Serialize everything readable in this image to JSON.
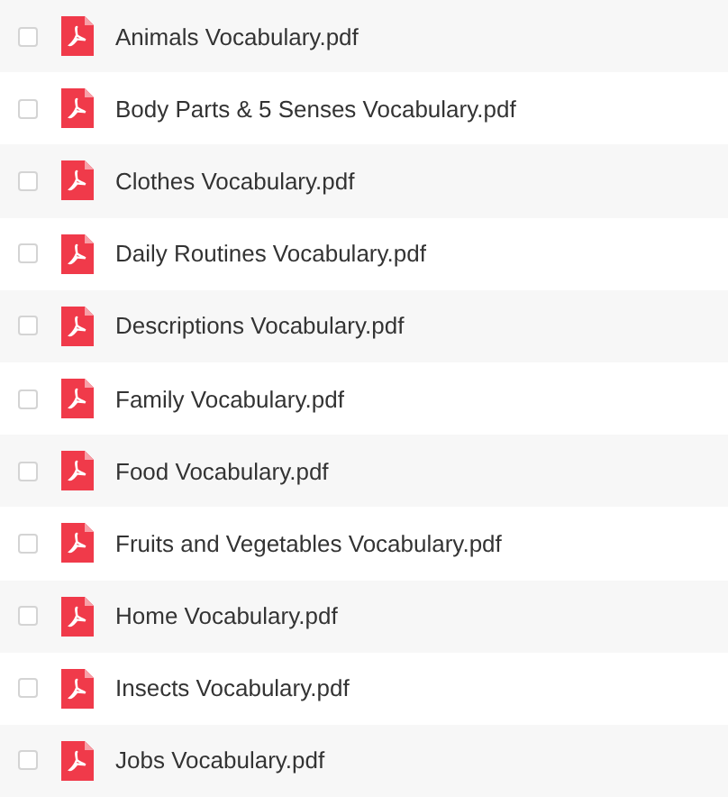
{
  "files": [
    {
      "name": "Animals Vocabulary.pdf",
      "checked": false
    },
    {
      "name": "Body Parts & 5 Senses Vocabulary.pdf",
      "checked": false
    },
    {
      "name": "Clothes Vocabulary.pdf",
      "checked": false
    },
    {
      "name": "Daily Routines Vocabulary.pdf",
      "checked": false
    },
    {
      "name": "Descriptions Vocabulary.pdf",
      "checked": false
    },
    {
      "name": "Family Vocabulary.pdf",
      "checked": false
    },
    {
      "name": "Food Vocabulary.pdf",
      "checked": false
    },
    {
      "name": "Fruits and Vegetables Vocabulary.pdf",
      "checked": false
    },
    {
      "name": "Home Vocabulary.pdf",
      "checked": false
    },
    {
      "name": "Insects Vocabulary.pdf",
      "checked": false
    },
    {
      "name": "Jobs Vocabulary.pdf",
      "checked": false
    }
  ]
}
